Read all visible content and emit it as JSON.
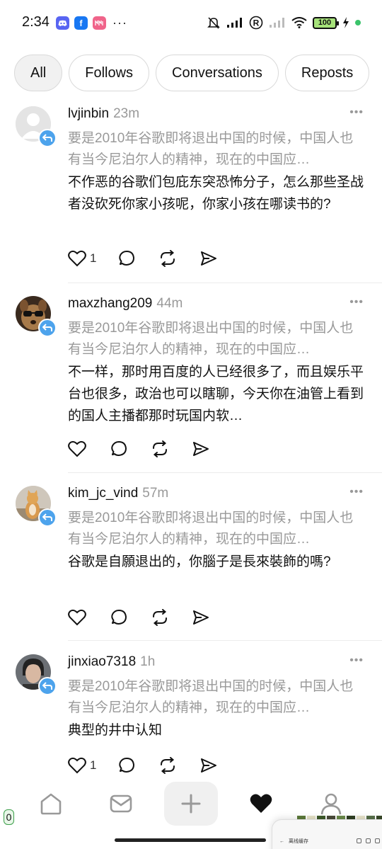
{
  "status": {
    "time": "2:34",
    "battery": "100",
    "app_icons": [
      "discord-icon",
      "facebook-icon",
      "pink-app-icon"
    ],
    "colors": {
      "discord": "#5865f2",
      "facebook": "#1877f2",
      "pink_app": "#f0648a",
      "battery_fill": "#a6e27a",
      "dot": "#3ac36a"
    }
  },
  "tabs": [
    {
      "label": "All",
      "active": true
    },
    {
      "label": "Follows",
      "active": false
    },
    {
      "label": "Conversations",
      "active": false
    },
    {
      "label": "Reposts",
      "active": false
    }
  ],
  "posts": [
    {
      "username": "lvjinbin",
      "time": "23m",
      "quote": "要是2010年谷歌即将退出中国的时候，中国人也有当今尼泊尔人的精神，现在的中国应…",
      "content": "不作恶的谷歌们包庇东突恐怖分子，怎么那些圣战者没砍死你家小孩呢，你家小孩在哪读书的?",
      "likes": "1",
      "avatar": "default-user-avatar"
    },
    {
      "username": "maxzhang209",
      "time": "44m",
      "quote": "要是2010年谷歌即将退出中国的时候，中国人也有当今尼泊尔人的精神，现在的中国应…",
      "content": "不一样，那时用百度的人已经很多了，而且娱乐平台也很多，政治也可以瞎聊，今天你在油管上看到的国人主播都那时玩国内软…",
      "likes": "",
      "avatar": "dog-with-sunglasses-avatar"
    },
    {
      "username": "kim_jc_vind",
      "time": "57m",
      "quote": "要是2010年谷歌即将退出中国的时候，中国人也有当今尼泊尔人的精神，现在的中国应…",
      "content": "谷歌是自願退出的，你腦子是長來裝飾的嗎?",
      "likes": "",
      "avatar": "cat-photo-avatar"
    },
    {
      "username": "jinxiao7318",
      "time": "1h",
      "quote": "要是2010年谷歌即将退出中国的时候，中国人也有当今尼泊尔人的精神，现在的中国应…",
      "content": "典型的井中认知",
      "likes": "1",
      "avatar": "person-photo-avatar"
    }
  ],
  "bottom_nav": [
    "home-icon",
    "messages-icon",
    "new-post-icon",
    "activity-icon",
    "profile-icon"
  ],
  "overlay": {
    "left_badge": "0",
    "floating_window_title": "离线缓存"
  }
}
